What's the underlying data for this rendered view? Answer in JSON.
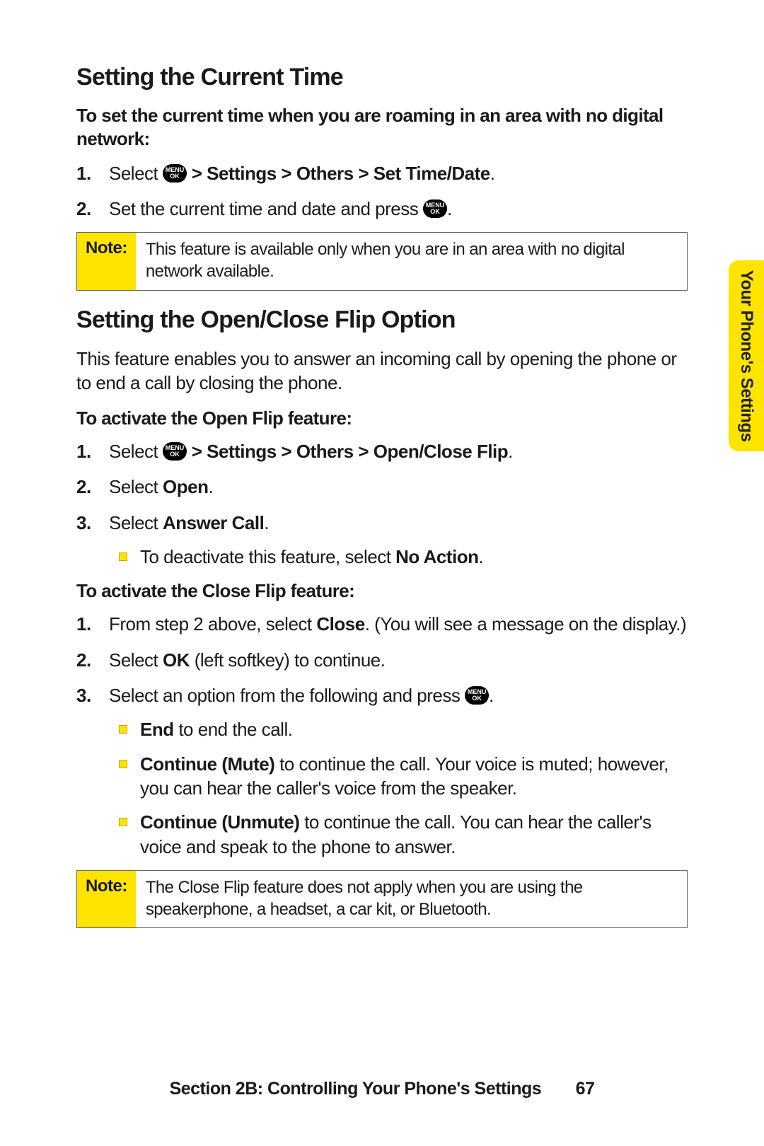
{
  "side_tab": "Your Phone's Settings",
  "section1": {
    "heading": "Setting the Current Time",
    "intro": "To set the current time when you are roaming in an area with no digital network:",
    "steps": {
      "s1_prefix": "Select ",
      "s1_bold": " > Settings > Others > Set Time/Date",
      "s2_prefix": "Set the current time and date and press "
    },
    "note_label": "Note:",
    "note_text": "This feature is available only when you are in an area with no digital network available."
  },
  "section2": {
    "heading": "Setting the Open/Close Flip Option",
    "para": "This feature enables you to answer an incoming call by opening the phone or to end a call by closing the phone.",
    "open": {
      "sub": "To activate the Open Flip feature:",
      "s1_prefix": "Select ",
      "s1_bold": " > Settings > Others > Open/Close Flip",
      "s2_prefix": "Select ",
      "s2_bold": "Open",
      "s3_prefix": "Select ",
      "s3_bold": "Answer Call",
      "bullet_prefix": "To deactivate this feature, select ",
      "bullet_bold": "No Action"
    },
    "close": {
      "sub": "To activate the Close Flip feature:",
      "s1_prefix": "From step 2 above, select ",
      "s1_bold": "Close",
      "s1_suffix": ". (You will see a message on the display.)",
      "s2_prefix": "Select ",
      "s2_bold": "OK",
      "s2_suffix": " (left softkey) to continue.",
      "s3_prefix": "Select an option from the following and press ",
      "b1_bold": "End",
      "b1_suffix": " to end the call.",
      "b2_bold": "Continue (Mute)",
      "b2_suffix": " to continue the call. Your voice is muted; however, you can hear the caller's voice from the speaker.",
      "b3_bold": "Continue (Unmute)",
      "b3_suffix": " to continue the call. You can hear the caller's voice and speak to the phone to answer."
    },
    "note_label": "Note:",
    "note_text": "The Close Flip feature does not apply when you are using the speakerphone, a headset, a car kit, or Bluetooth."
  },
  "footer": {
    "text": "Section 2B: Controlling Your Phone's Settings",
    "page": "67"
  }
}
